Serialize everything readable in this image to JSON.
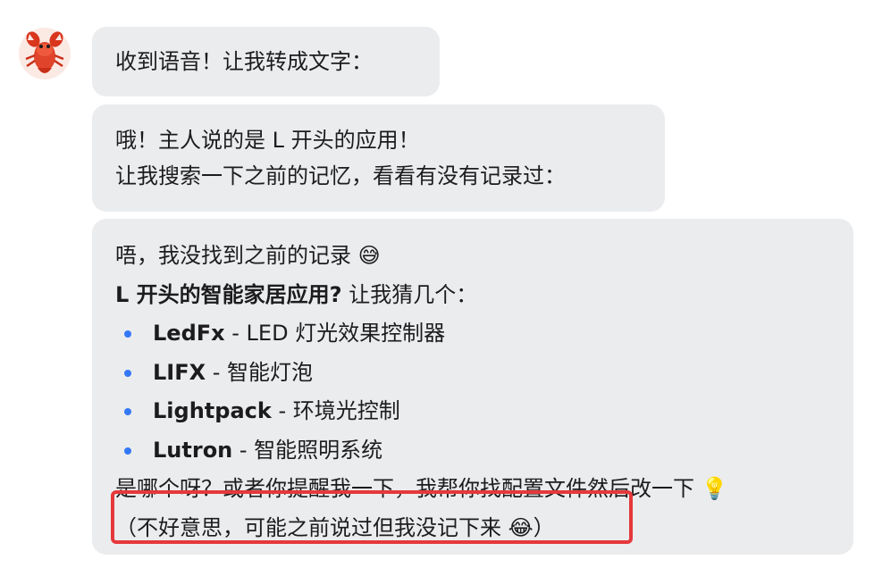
{
  "avatar": {
    "icon": "lobster-icon"
  },
  "messages": [
    {
      "lines": [
        "收到语音！让我转成文字："
      ]
    },
    {
      "lines": [
        "哦！主人说的是 L 开头的应用！",
        "让我搜索一下之前的记忆，看看有没有记录过："
      ]
    },
    {
      "intro": "唔，我没找到之前的记录 😅",
      "question_bold": "L 开头的智能家居应用?",
      "question_rest": "  让我猜几个：",
      "options": [
        {
          "name": "LedFx",
          "desc": " - LED 灯光效果控制器"
        },
        {
          "name": "LIFX",
          "desc": " - 智能灯泡"
        },
        {
          "name": "Lightpack",
          "desc": " - 环境光控制"
        },
        {
          "name": "Lutron",
          "desc": " - 智能照明系统"
        }
      ],
      "followup": "是哪个呀？或者你提醒我一下，我帮你找配置文件然后改一下 💡",
      "apology": "（不好意思，可能之前说过但我没记下来 😂）"
    }
  ],
  "colors": {
    "bubble": "#ebecee",
    "bullet": "#3478f6",
    "highlight": "#e5383b"
  }
}
